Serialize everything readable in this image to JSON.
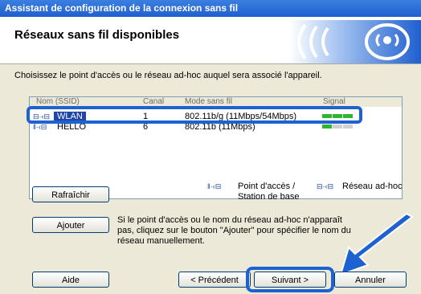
{
  "window": {
    "title": "Assistant de configuration de la connexion sans fil"
  },
  "header": {
    "title": "Réseaux sans fil disponibles",
    "logo": "wireless-logo"
  },
  "instruction": "Choisissez le point d'accès ou le réseau ad-hoc auquel sera associé l'appareil.",
  "list": {
    "columns": [
      "Nom (SSID)",
      "Canal",
      "Mode sans fil",
      "Signal"
    ],
    "rows": [
      {
        "name": "WLAN",
        "channel": "1",
        "mode": "802.11b/g (11Mbps/54Mbps)",
        "signal": 1.0,
        "type": "adhoc",
        "selected": true
      },
      {
        "name": "HELLO",
        "channel": "6",
        "mode": "802.11b (11Mbps)",
        "signal": 0.33,
        "type": "ap",
        "selected": false
      }
    ]
  },
  "legend": {
    "ap_label": "Point d'accès / Station de base",
    "adhoc_label": "Réseau ad-hoc"
  },
  "note": "Si le point d'accès ou le nom du réseau ad-hoc n'apparaît pas, cliquez sur le bouton \"Ajouter\" pour spécifier le nom du réseau manuellement.",
  "buttons": {
    "refresh": "Rafraîchir",
    "add": "Ajouter",
    "help": "Aide",
    "back": "< Précédent",
    "next": "Suivant >",
    "cancel": "Annuler"
  },
  "colors": {
    "accent": "#1e62d1",
    "signal_on": "#2fb52f",
    "signal_off": "#d0d0d0"
  }
}
